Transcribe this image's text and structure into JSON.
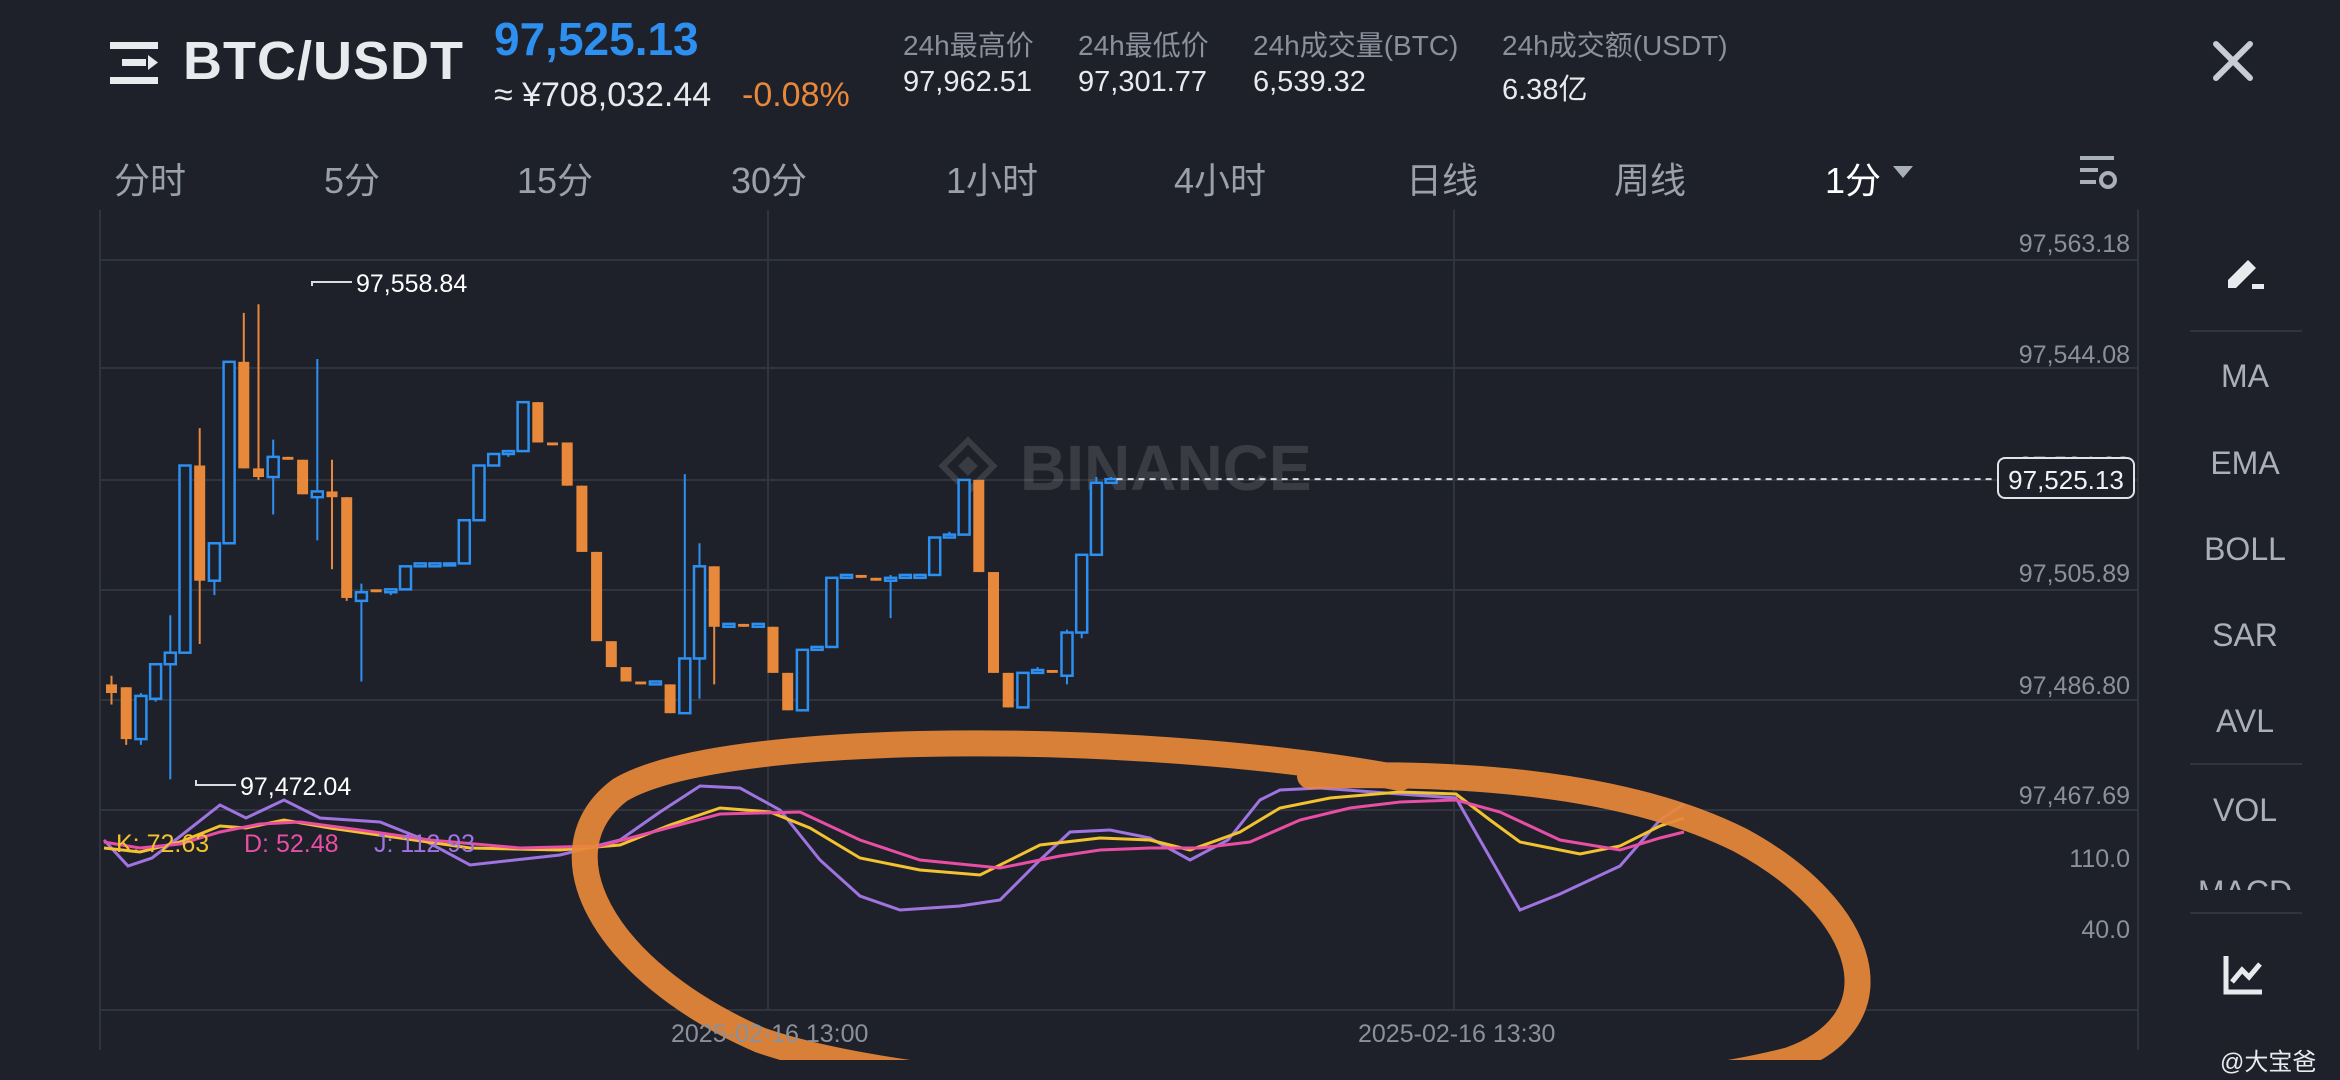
{
  "header": {
    "pair": "BTC/USDT",
    "price": "97,525.13",
    "cny_price": "≈ ¥708,032.44",
    "change_pct": "-0.08%",
    "stats": [
      {
        "label": "24h最高价",
        "value": "97,962.51"
      },
      {
        "label": "24h最低价",
        "value": "97,301.77"
      },
      {
        "label": "24h成交量(BTC)",
        "value": "6,539.32"
      },
      {
        "label": "24h成交额(USDT)",
        "value": "6.38亿"
      }
    ]
  },
  "tabs": [
    "分时",
    "5分",
    "15分",
    "30分",
    "1小时",
    "4小时",
    "日线",
    "周线",
    "1分"
  ],
  "selected_interval": "1分",
  "chart": {
    "y_ticks": [
      "97,563.18",
      "97,544.08",
      "97,505.89",
      "97,486.80",
      "97,467.69"
    ],
    "hidden_tick": "97,524.98",
    "current_price_tag": "97,525.13",
    "high_marker": "97,558.84",
    "low_marker": "97,472.04",
    "x_labels": [
      "2025-02-16 13:00",
      "2025-02-16 13:30"
    ],
    "watermark": "BINANCE"
  },
  "kdj": {
    "k_label": "K: 72.63",
    "d_label": "D: 52.48",
    "j_label": "J: 112.93",
    "y_ticks": [
      "110.0",
      "40.0"
    ]
  },
  "sidebar": {
    "items": [
      "MA",
      "EMA",
      "BOLL",
      "SAR",
      "AVL",
      "VOL",
      "MACD"
    ]
  },
  "watermark_user": "@大宝爸",
  "colors": {
    "up": "#2d8ff0",
    "down": "#e8883a",
    "k": "#f2c230",
    "d": "#e84ea4",
    "j": "#a074e0",
    "annotation": "#e8883a"
  },
  "chart_data": {
    "type": "candlestick",
    "interval": "1分",
    "candles": [
      {
        "o": 97489.5,
        "h": 97491.0,
        "l": 97486.0,
        "c": 97488.0
      },
      {
        "o": 97489.0,
        "h": 97489.0,
        "l": 97479.0,
        "c": 97480.0
      },
      {
        "o": 97480.0,
        "h": 97488.0,
        "l": 97479.0,
        "c": 97487.5
      },
      {
        "o": 97487.0,
        "h": 97492.5,
        "l": 97486.5,
        "c": 97493.0
      },
      {
        "o": 97493.0,
        "h": 97501.5,
        "l": 97473.0,
        "c": 97495.0
      },
      {
        "o": 97495.0,
        "h": 97527.5,
        "l": 97495.0,
        "c": 97527.5
      },
      {
        "o": 97527.5,
        "h": 97534.0,
        "l": 97496.5,
        "c": 97507.5
      },
      {
        "o": 97507.5,
        "h": 97513.0,
        "l": 97505.0,
        "c": 97514.0
      },
      {
        "o": 97514.0,
        "h": 97545.5,
        "l": 97514.0,
        "c": 97545.5
      },
      {
        "o": 97545.5,
        "h": 97554.0,
        "l": 97527.0,
        "c": 97527.0
      },
      {
        "o": 97527.0,
        "h": 97555.5,
        "l": 97525.0,
        "c": 97525.5
      },
      {
        "o": 97525.5,
        "h": 97532.0,
        "l": 97519.0,
        "c": 97529.0
      },
      {
        "o": 97529.0,
        "h": 97529.0,
        "l": 97529.0,
        "c": 97528.5
      },
      {
        "o": 97528.5,
        "h": 97528.5,
        "l": 97522.5,
        "c": 97522.5
      },
      {
        "o": 97522.0,
        "h": 97546.0,
        "l": 97514.5,
        "c": 97523.0
      },
      {
        "o": 97523.0,
        "h": 97528.5,
        "l": 97509.5,
        "c": 97522.0
      },
      {
        "o": 97522.0,
        "h": 97522.0,
        "l": 97504.0,
        "c": 97504.5
      },
      {
        "o": 97504.0,
        "h": 97507.0,
        "l": 97490.0,
        "c": 97505.5
      },
      {
        "o": 97506.0,
        "h": 97506.0,
        "l": 97506.0,
        "c": 97505.5
      },
      {
        "o": 97505.5,
        "h": 97506.0,
        "l": 97505.0,
        "c": 97506.0
      },
      {
        "o": 97506.0,
        "h": 97509.0,
        "l": 97506.0,
        "c": 97510.0
      },
      {
        "o": 97510.0,
        "h": 97510.5,
        "l": 97510.0,
        "c": 97510.5
      },
      {
        "o": 97510.0,
        "h": 97510.5,
        "l": 97510.0,
        "c": 97510.5
      },
      {
        "o": 97510.5,
        "h": 97510.5,
        "l": 97510.0,
        "c": 97510.5
      },
      {
        "o": 97510.5,
        "h": 97518.0,
        "l": 97510.5,
        "c": 97518.0
      },
      {
        "o": 97518.0,
        "h": 97527.5,
        "l": 97518.0,
        "c": 97527.5
      },
      {
        "o": 97527.5,
        "h": 97529.5,
        "l": 97527.5,
        "c": 97529.5
      },
      {
        "o": 97529.5,
        "h": 97530.0,
        "l": 97529.0,
        "c": 97530.0
      },
      {
        "o": 97530.0,
        "h": 97538.5,
        "l": 97530.0,
        "c": 97538.5
      },
      {
        "o": 97538.5,
        "h": 97538.5,
        "l": 97531.5,
        "c": 97531.5
      },
      {
        "o": 97531.5,
        "h": 97531.5,
        "l": 97531.0,
        "c": 97531.0
      },
      {
        "o": 97531.5,
        "h": 97531.5,
        "l": 97524.0,
        "c": 97524.0
      },
      {
        "o": 97524.0,
        "h": 97524.0,
        "l": 97512.5,
        "c": 97512.5
      },
      {
        "o": 97512.5,
        "h": 97512.5,
        "l": 97497.0,
        "c": 97497.0
      },
      {
        "o": 97497.0,
        "h": 97497.0,
        "l": 97492.5,
        "c": 97492.5
      },
      {
        "o": 97492.5,
        "h": 97492.5,
        "l": 97490.0,
        "c": 97490.0
      },
      {
        "o": 97490.0,
        "h": 97490.0,
        "l": 97489.5,
        "c": 97489.5
      },
      {
        "o": 97489.5,
        "h": 97490.0,
        "l": 97489.5,
        "c": 97490.0
      },
      {
        "o": 97489.5,
        "h": 97489.5,
        "l": 97484.5,
        "c": 97484.5
      },
      {
        "o": 97484.5,
        "h": 97526.0,
        "l": 97484.5,
        "c": 97494.0
      },
      {
        "o": 97494.0,
        "h": 97514.0,
        "l": 97487.0,
        "c": 97510.0
      },
      {
        "o": 97510.0,
        "h": 97510.0,
        "l": 97489.5,
        "c": 97499.5
      },
      {
        "o": 97499.5,
        "h": 97500.0,
        "l": 97499.5,
        "c": 97500.0
      },
      {
        "o": 97500.0,
        "h": 97500.0,
        "l": 97499.5,
        "c": 97499.5
      },
      {
        "o": 97499.5,
        "h": 97500.0,
        "l": 97499.5,
        "c": 97500.0
      },
      {
        "o": 97499.5,
        "h": 97499.5,
        "l": 97491.5,
        "c": 97491.5
      },
      {
        "o": 97491.5,
        "h": 97491.5,
        "l": 97485.0,
        "c": 97485.0
      },
      {
        "o": 97485.0,
        "h": 97495.5,
        "l": 97485.0,
        "c": 97495.5
      },
      {
        "o": 97495.5,
        "h": 97496.0,
        "l": 97495.5,
        "c": 97496.0
      },
      {
        "o": 97496.0,
        "h": 97508.0,
        "l": 97496.0,
        "c": 97508.0
      },
      {
        "o": 97508.0,
        "h": 97508.5,
        "l": 97508.0,
        "c": 97508.5
      },
      {
        "o": 97508.5,
        "h": 97508.5,
        "l": 97508.0,
        "c": 97508.0
      },
      {
        "o": 97508.0,
        "h": 97508.0,
        "l": 97507.5,
        "c": 97507.5
      },
      {
        "o": 97507.5,
        "h": 97508.5,
        "l": 97501.0,
        "c": 97508.0
      },
      {
        "o": 97508.0,
        "h": 97508.5,
        "l": 97508.0,
        "c": 97508.5
      },
      {
        "o": 97508.0,
        "h": 97508.5,
        "l": 97508.0,
        "c": 97508.5
      },
      {
        "o": 97508.5,
        "h": 97515.0,
        "l": 97508.5,
        "c": 97515.0
      },
      {
        "o": 97515.0,
        "h": 97516.0,
        "l": 97515.0,
        "c": 97515.5
      },
      {
        "o": 97515.5,
        "h": 97525.0,
        "l": 97515.5,
        "c": 97525.0
      },
      {
        "o": 97525.0,
        "h": 97525.0,
        "l": 97509.0,
        "c": 97509.0
      },
      {
        "o": 97509.0,
        "h": 97509.0,
        "l": 97491.5,
        "c": 97491.5
      },
      {
        "o": 97491.5,
        "h": 97491.5,
        "l": 97485.5,
        "c": 97485.5
      },
      {
        "o": 97485.5,
        "h": 97491.5,
        "l": 97485.5,
        "c": 97491.5
      },
      {
        "o": 97491.5,
        "h": 97492.5,
        "l": 97491.5,
        "c": 97492.0
      },
      {
        "o": 97492.0,
        "h": 97492.0,
        "l": 97491.5,
        "c": 97491.5
      },
      {
        "o": 97491.0,
        "h": 97499.0,
        "l": 97489.5,
        "c": 97498.5
      },
      {
        "o": 97498.5,
        "h": 97498.5,
        "l": 97497.5,
        "c": 97512.0
      },
      {
        "o": 97512.0,
        "h": 97525.5,
        "l": 97512.0,
        "c": 97524.5
      },
      {
        "o": 97524.5,
        "h": 97525.5,
        "l": 97524.5,
        "c": 97525.13
      }
    ],
    "kdj": {
      "k": 72.63,
      "d": 52.48,
      "j": 112.93
    },
    "y_range": [
      97464,
      97566
    ]
  }
}
